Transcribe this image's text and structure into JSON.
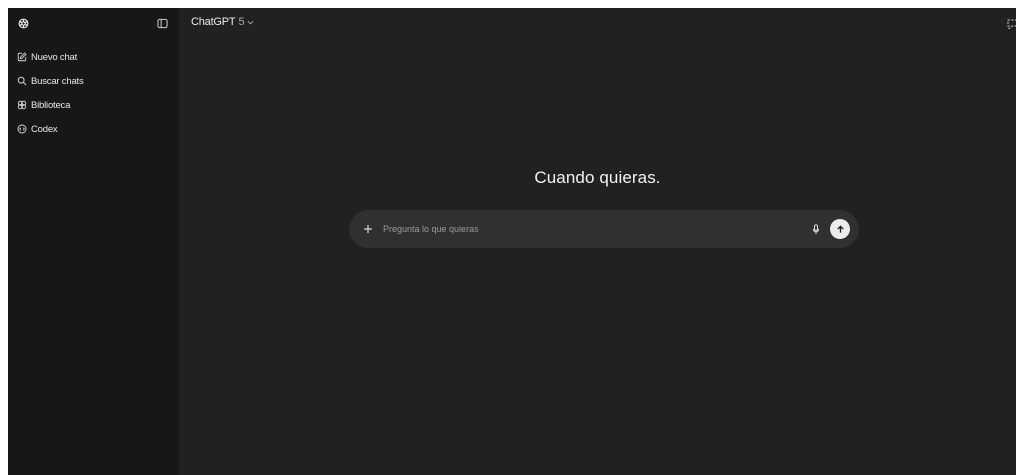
{
  "sidebar": {
    "items": [
      {
        "label": "Nuevo chat",
        "icon": "edit-icon"
      },
      {
        "label": "Buscar chats",
        "icon": "search-icon"
      },
      {
        "label": "Biblioteca",
        "icon": "library-icon"
      },
      {
        "label": "Codex",
        "icon": "codex-icon"
      }
    ]
  },
  "header": {
    "model_name": "ChatGPT",
    "model_version": "5"
  },
  "main": {
    "headline": "Cuando quieras.",
    "composer": {
      "placeholder": "Pregunta lo que quieras"
    }
  },
  "colors": {
    "sidebar_bg": "#171717",
    "main_bg": "#212121",
    "composer_bg": "#303030",
    "text": "#ececec"
  }
}
